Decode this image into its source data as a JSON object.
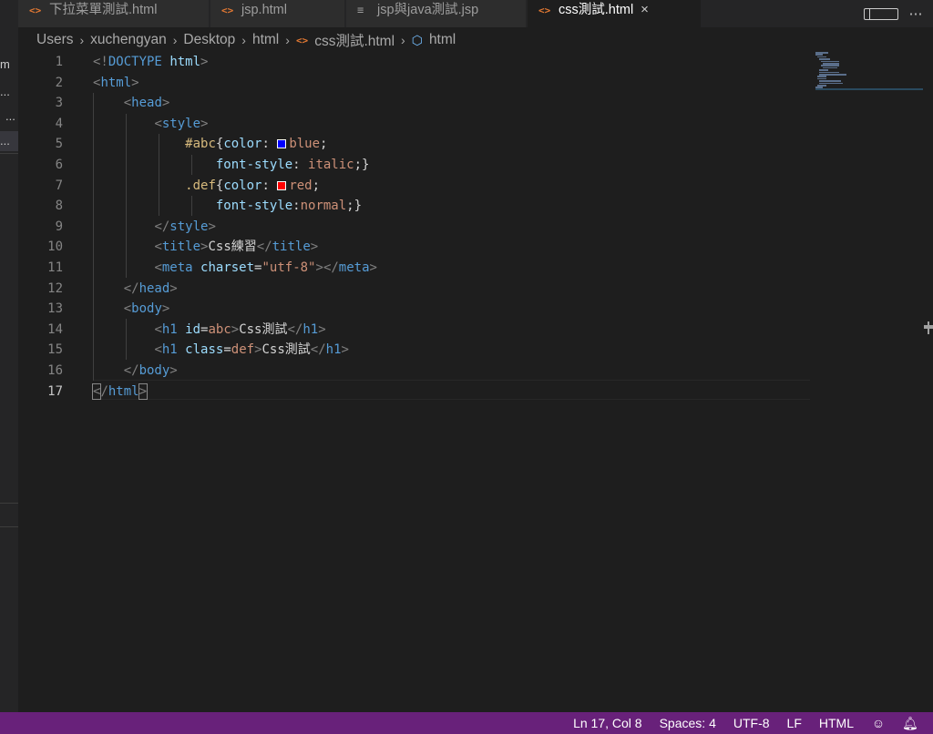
{
  "sidebar": {
    "rows": [
      "m",
      "...",
      "...",
      "..."
    ]
  },
  "tabs": [
    {
      "label": "下拉菜單測試.html",
      "icon": "html-code-icon",
      "active": false
    },
    {
      "label": "jsp.html",
      "icon": "html-code-icon",
      "active": false
    },
    {
      "label": "jsp與java測試.jsp",
      "icon": "text-lines-icon",
      "active": false
    },
    {
      "label": "css測試.html",
      "icon": "html-code-icon",
      "active": true,
      "close": "×"
    }
  ],
  "tab_actions": {
    "more": "⋯"
  },
  "breadcrumb": {
    "segments": [
      "Users",
      "xuchengyan",
      "Desktop",
      "html",
      "css測試.html",
      "html"
    ],
    "separator": "›"
  },
  "editor": {
    "line_numbers": [
      "1",
      "2",
      "3",
      "4",
      "5",
      "6",
      "7",
      "8",
      "9",
      "10",
      "11",
      "12",
      "13",
      "14",
      "15",
      "16",
      "17"
    ],
    "current_line": "17",
    "lines": [
      {
        "t": "<!DOCTYPE html>"
      },
      {
        "t": "<html>"
      },
      {
        "t": "<head>"
      },
      {
        "t": "<style>"
      },
      {
        "t": "#abc{color: blue;",
        "swatch": "#0000ff"
      },
      {
        "t": "font-style: italic;}"
      },
      {
        "t": ".def{color: red;",
        "swatch": "#ff0000"
      },
      {
        "t": "font-style:normal;}"
      },
      {
        "t": "</style>"
      },
      {
        "t": "<title>Css練習</title>"
      },
      {
        "t": "<meta charset=\"utf-8\"></meta>"
      },
      {
        "t": "</head>"
      },
      {
        "t": "<body>"
      },
      {
        "t": "<h1 id=abc>Css測試</h1>"
      },
      {
        "t": "<h1 class=def>Css測試</h1>"
      },
      {
        "t": "</body>"
      },
      {
        "t": "</html>"
      }
    ]
  },
  "statusbar": {
    "position": "Ln 17, Col 8",
    "indent": "Spaces: 4",
    "encoding": "UTF-8",
    "eol": "LF",
    "language": "HTML",
    "icons": [
      "feedback-icon",
      "bell-icon"
    ]
  },
  "colors": {
    "statusbar_bg": "#68217a",
    "editor_bg": "#1e1e1e",
    "tag": "#569cd6",
    "attribute": "#9cdcfe",
    "string": "#ce9178",
    "selector": "#d7ba7d"
  }
}
